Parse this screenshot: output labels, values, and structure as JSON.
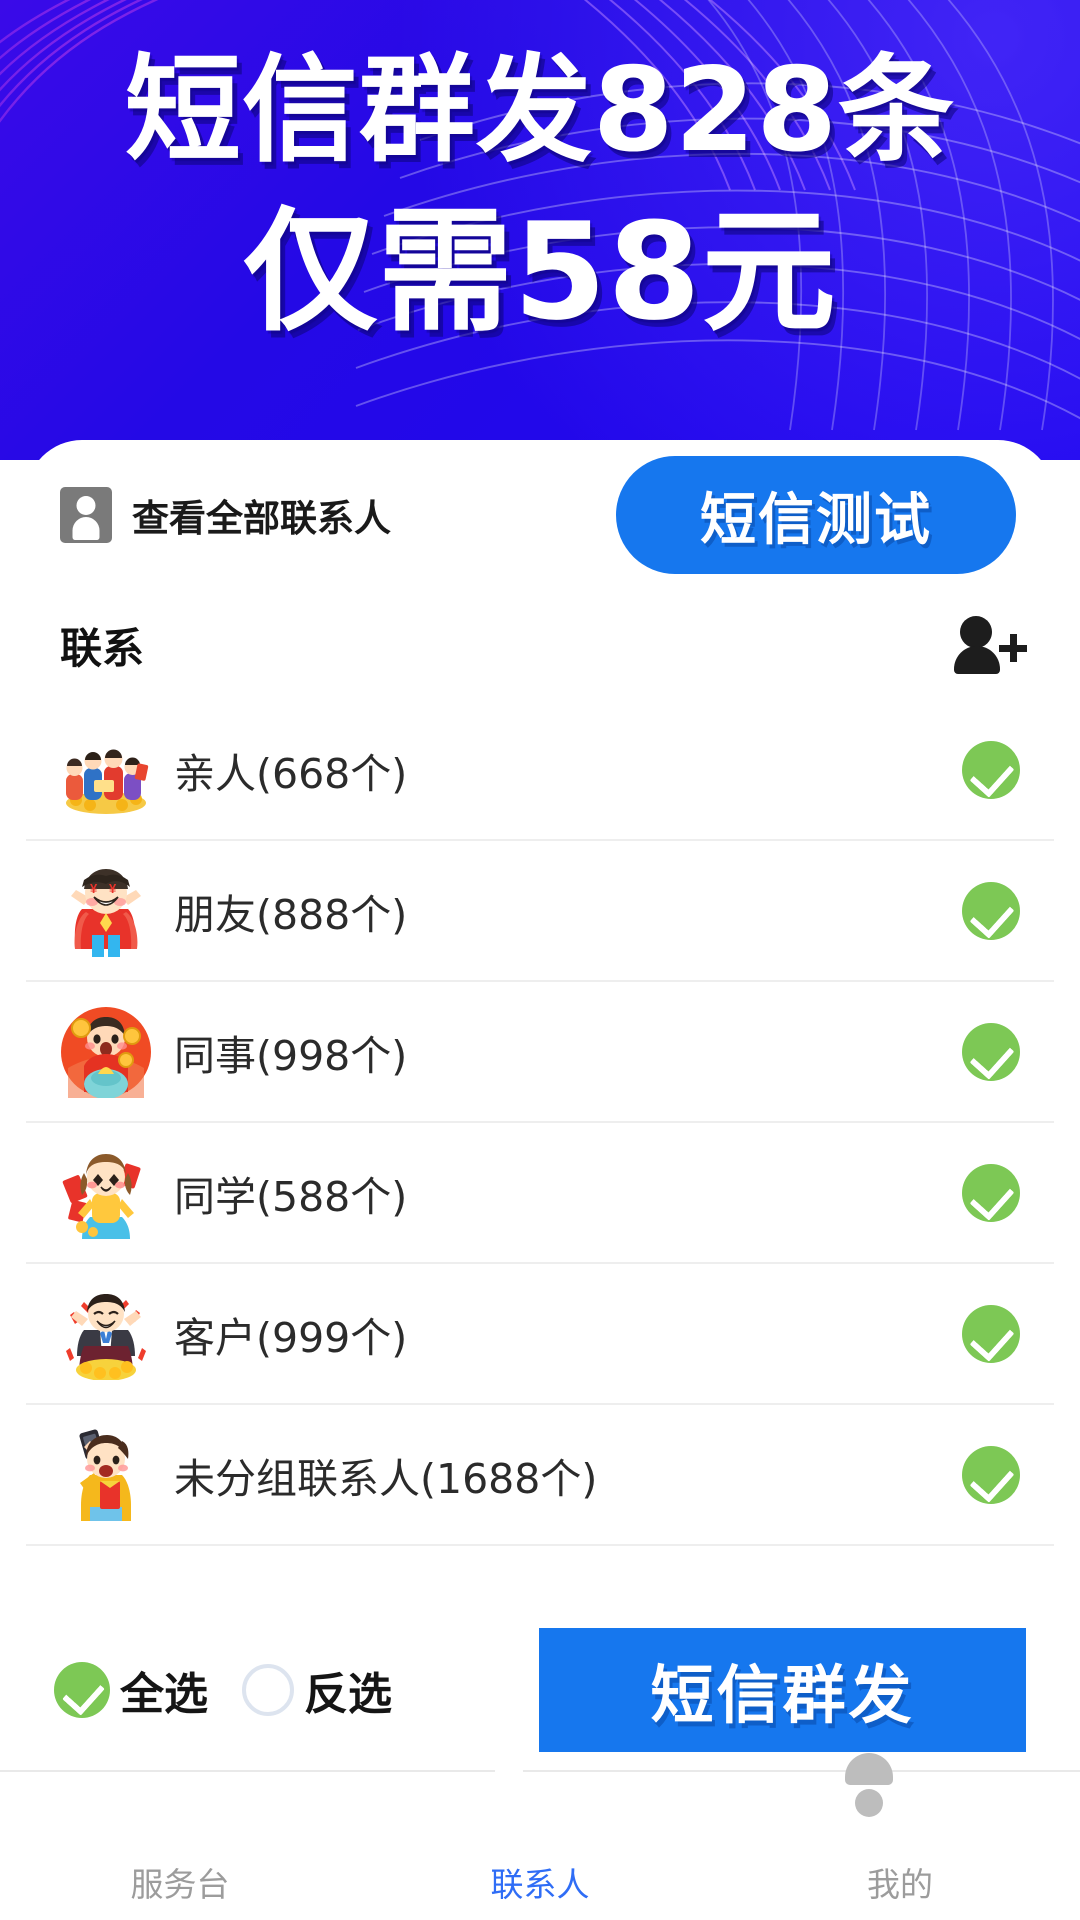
{
  "banner": {
    "line1": "短信群发828条",
    "line2": "仅需58元",
    "bg_color": "#2409E6",
    "text_color": "#FFFFFF"
  },
  "card": {
    "view_all_contacts_label": "查看全部联系人",
    "view_all_contacts_icon": "contact-badge-icon",
    "sms_test_button": "短信测试",
    "sms_test_button_color": "#1677EE",
    "section_title": "联系",
    "add_contact_icon": "add-person-icon",
    "check_color": "#7DC855",
    "groups": [
      {
        "name": "亲人(668个)",
        "checked": true,
        "avatar": "family-group-avatar"
      },
      {
        "name": "朋友(888个)",
        "checked": true,
        "avatar": "cheering-friend-avatar"
      },
      {
        "name": "同事(998个)",
        "checked": true,
        "avatar": "coin-coworker-avatar"
      },
      {
        "name": "同学(588个)",
        "checked": true,
        "avatar": "girl-classmate-avatar"
      },
      {
        "name": "客户(999个)",
        "checked": true,
        "avatar": "businessman-client-avatar"
      },
      {
        "name": "未分组联系人(1688个)",
        "checked": true,
        "avatar": "phone-person-avatar"
      }
    ],
    "select_all_label": "全选",
    "select_all_checked": true,
    "invert_label": "反选",
    "invert_checked": false,
    "send_button": "短信群发",
    "send_button_color": "#1677EE"
  },
  "tabbar": {
    "tabs": [
      {
        "label": "服务台",
        "icon": "service-desk-icon",
        "active": false
      },
      {
        "label": "联系人",
        "icon": "contacts-icon",
        "active": true
      },
      {
        "label": "我的",
        "icon": "profile-icon",
        "active": false
      }
    ],
    "active_color": "#2F6DF6",
    "inactive_color": "#9C9C9C"
  }
}
